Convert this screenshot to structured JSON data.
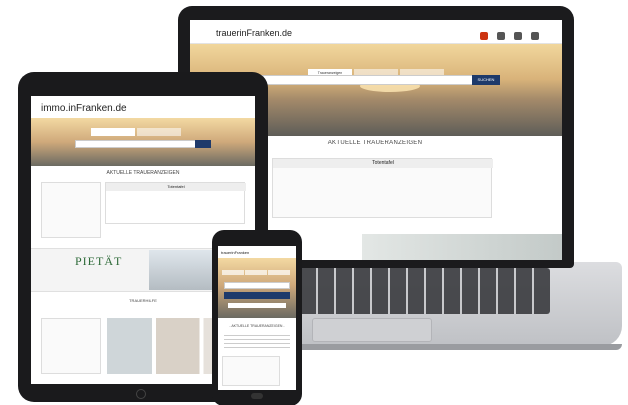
{
  "laptop": {
    "logo": "trauerinFranken.de",
    "section_title": "AKTUELLE TRAUERANZEIGEN",
    "card_title": "Totentafel",
    "search_button": "SUCHEN",
    "tabs": [
      "Traueranzeigen",
      "",
      ""
    ]
  },
  "tablet": {
    "logo": "immo.inFranken.de",
    "section_title": "AKTUELLE TRAUERANZEIGEN",
    "notice_title": "Totentafel",
    "ad_title": "PIETÄT",
    "section_title_2": "TRAUERHILFE"
  },
  "phone": {
    "logo": "trauerinFranken",
    "section_title": "- AKTUELLE TRAUERANZEIGEN -"
  },
  "colors": {
    "brand_red": "#c31",
    "search_button": "#1e3a6b",
    "device_frame": "#1a1a1c",
    "ad_green": "#2f6b3a"
  }
}
